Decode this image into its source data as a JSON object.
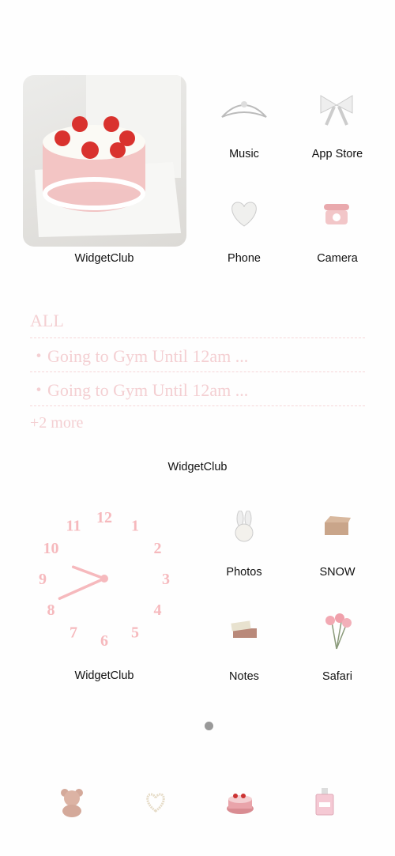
{
  "widgets": {
    "photo_widget": {
      "label": "WidgetClub"
    },
    "todo_widget": {
      "header": "ALL",
      "items": [
        "・Going to Gym Until 12am ...",
        "・Going to Gym Until 12am ..."
      ],
      "more": "+2 more",
      "label": "WidgetClub"
    },
    "clock_widget": {
      "label": "WidgetClub",
      "time": "9:41",
      "numbers": [
        "12",
        "1",
        "2",
        "3",
        "4",
        "5",
        "6",
        "7",
        "8",
        "9",
        "10",
        "11"
      ],
      "color": "#f6b9bd"
    }
  },
  "apps": [
    {
      "label": "Music",
      "icon": "tiara-icon"
    },
    {
      "label": "App Store",
      "icon": "bow-icon"
    },
    {
      "label": "Phone",
      "icon": "heart-icon"
    },
    {
      "label": "Camera",
      "icon": "telephone-icon"
    },
    {
      "label": "Photos",
      "icon": "bunny-icon"
    },
    {
      "label": "SNOW",
      "icon": "box-icon"
    },
    {
      "label": "Notes",
      "icon": "books-icon"
    },
    {
      "label": "Safari",
      "icon": "roses-icon"
    }
  ],
  "page_indicator": {
    "pages": 1,
    "current": 1
  },
  "dock": [
    {
      "icon": "teddy-bear-icon"
    },
    {
      "icon": "pearl-heart-icon"
    },
    {
      "icon": "cake-icon"
    },
    {
      "icon": "perfume-icon"
    }
  ]
}
